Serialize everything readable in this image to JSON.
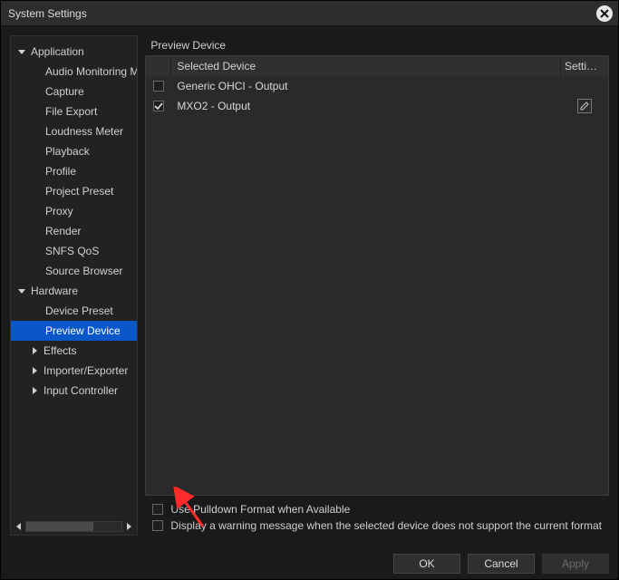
{
  "titlebar": {
    "title": "System Settings"
  },
  "sidebar": {
    "items": [
      {
        "kind": "section",
        "label": "Application",
        "expanded": true
      },
      {
        "kind": "child",
        "label": "Audio Monitoring Mode"
      },
      {
        "kind": "child",
        "label": "Capture"
      },
      {
        "kind": "child",
        "label": "File Export"
      },
      {
        "kind": "child",
        "label": "Loudness Meter"
      },
      {
        "kind": "child",
        "label": "Playback"
      },
      {
        "kind": "child",
        "label": "Profile"
      },
      {
        "kind": "child",
        "label": "Project Preset"
      },
      {
        "kind": "child",
        "label": "Proxy"
      },
      {
        "kind": "child",
        "label": "Render"
      },
      {
        "kind": "child",
        "label": "SNFS QoS"
      },
      {
        "kind": "child",
        "label": "Source Browser"
      },
      {
        "kind": "section",
        "label": "Hardware",
        "expanded": true
      },
      {
        "kind": "child",
        "label": "Device Preset"
      },
      {
        "kind": "child",
        "label": "Preview Device",
        "selected": true
      },
      {
        "kind": "section2",
        "label": "Effects",
        "expanded": false
      },
      {
        "kind": "section2",
        "label": "Importer/Exporter",
        "expanded": false
      },
      {
        "kind": "section2",
        "label": "Input Controller",
        "expanded": false
      }
    ]
  },
  "panel": {
    "title": "Preview Device",
    "columns": {
      "selected": "Selected Device",
      "settings": "Setti…"
    },
    "rows": [
      {
        "checked": false,
        "name": "Generic OHCI - Output",
        "hasSettings": false
      },
      {
        "checked": true,
        "name": "MXO2 - Output",
        "hasSettings": true
      }
    ],
    "options": {
      "pulldown": {
        "checked": false,
        "label": "Use Pulldown Format when Available"
      },
      "warning": {
        "checked": false,
        "label": "Display a warning message when the selected device does not support the current format"
      }
    }
  },
  "footer": {
    "ok": "OK",
    "cancel": "Cancel",
    "apply": "Apply"
  }
}
